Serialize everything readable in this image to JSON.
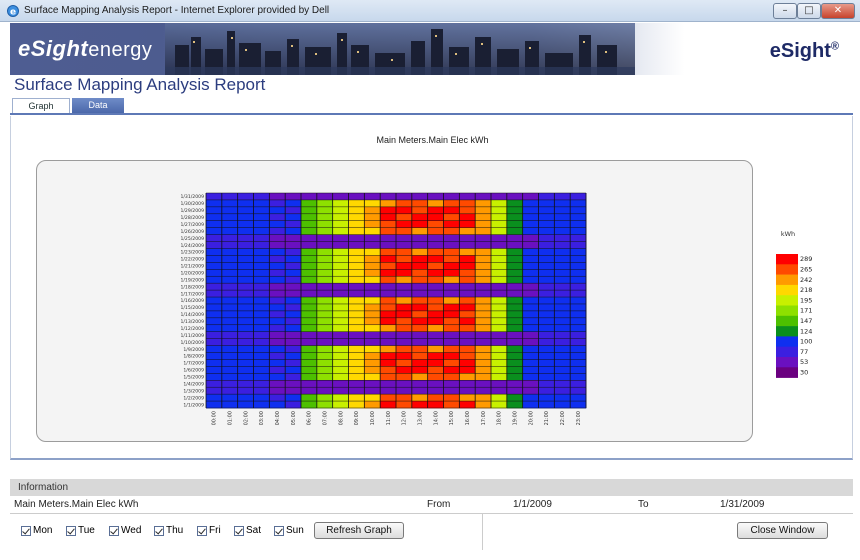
{
  "window": {
    "title": "Surface Mapping Analysis Report - Internet Explorer provided by Dell",
    "min_label": "–",
    "max_label": "□",
    "close_label": "✕"
  },
  "banner": {
    "logo_bold": "eSight",
    "logo_normal": "energy",
    "brand": "eSight",
    "brand_mark": "®"
  },
  "page_title": "Surface Mapping Analysis Report",
  "tabs": [
    {
      "label": "Graph",
      "active": true
    },
    {
      "label": "Data",
      "active": false
    }
  ],
  "chart_data": {
    "type": "heatmap",
    "title": "Main Meters.Main Elec kWh",
    "legend_title": "kWh",
    "legend_values": [
      "289",
      "265",
      "242",
      "218",
      "195",
      "171",
      "147",
      "124",
      "100",
      "77",
      "53",
      "30"
    ],
    "legend_colors": [
      "#ff0000",
      "#ff4a00",
      "#ff9a00",
      "#ffd800",
      "#c8f000",
      "#8ee000",
      "#4dc000",
      "#0a8f1e",
      "#0f2ff0",
      "#3b1fe0",
      "#6a10c0",
      "#6b0080"
    ],
    "y_categories": [
      "1/31/2009",
      "1/30/2009",
      "1/29/2009",
      "1/28/2009",
      "1/27/2009",
      "1/26/2009",
      "1/25/2009",
      "1/24/2009",
      "1/23/2009",
      "1/22/2009",
      "1/21/2009",
      "1/20/2009",
      "1/19/2009",
      "1/18/2009",
      "1/17/2009",
      "1/16/2009",
      "1/15/2009",
      "1/14/2009",
      "1/13/2009",
      "1/12/2009",
      "1/11/2009",
      "1/10/2009",
      "1/9/2009",
      "1/8/2009",
      "1/7/2009",
      "1/6/2009",
      "1/5/2009",
      "1/4/2009",
      "1/3/2009",
      "1/2/2009",
      "1/1/2009"
    ],
    "x_categories": [
      "00:00",
      "01:00",
      "02:00",
      "03:00",
      "04:00",
      "05:00",
      "06:00",
      "07:00",
      "08:00",
      "09:00",
      "10:00",
      "11:00",
      "12:00",
      "13:00",
      "14:00",
      "15:00",
      "16:00",
      "17:00",
      "18:00",
      "19:00",
      "20:00",
      "21:00",
      "22:00",
      "23:00"
    ]
  },
  "information": {
    "header": "Information",
    "meter": "Main Meters.Main Elec kWh",
    "from_label": "From",
    "from_value": "1/1/2009",
    "to_label": "To",
    "to_value": "1/31/2009"
  },
  "days": [
    {
      "label": "Mon",
      "checked": true
    },
    {
      "label": "Tue",
      "checked": true
    },
    {
      "label": "Wed",
      "checked": true
    },
    {
      "label": "Thu",
      "checked": true
    },
    {
      "label": "Fri",
      "checked": true
    },
    {
      "label": "Sat",
      "checked": true
    },
    {
      "label": "Sun",
      "checked": true
    }
  ],
  "buttons": {
    "refresh": "Refresh Graph",
    "close": "Close Window"
  }
}
